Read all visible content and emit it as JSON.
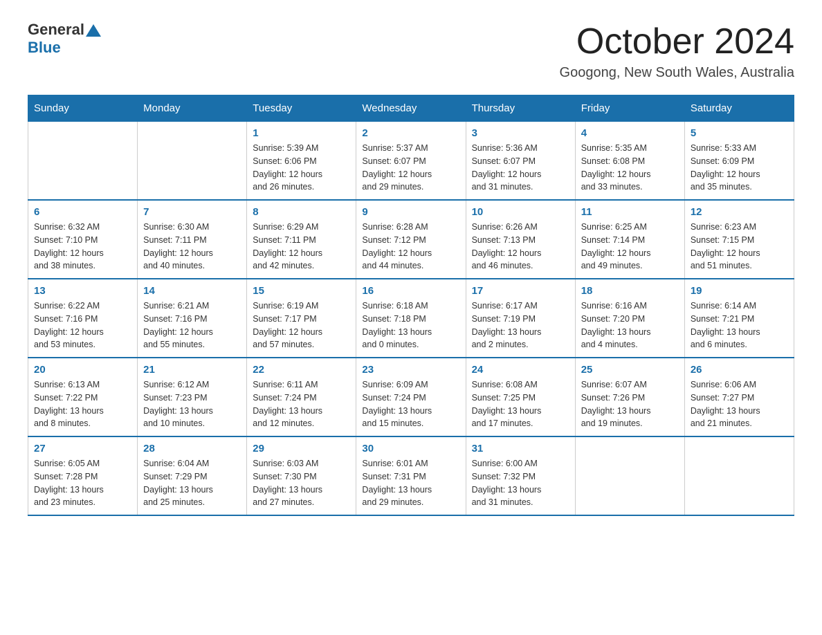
{
  "header": {
    "logo_general": "General",
    "logo_blue": "Blue",
    "title": "October 2024",
    "subtitle": "Googong, New South Wales, Australia"
  },
  "days_of_week": [
    "Sunday",
    "Monday",
    "Tuesday",
    "Wednesday",
    "Thursday",
    "Friday",
    "Saturday"
  ],
  "weeks": [
    [
      {
        "day": "",
        "info": ""
      },
      {
        "day": "",
        "info": ""
      },
      {
        "day": "1",
        "info": "Sunrise: 5:39 AM\nSunset: 6:06 PM\nDaylight: 12 hours\nand 26 minutes."
      },
      {
        "day": "2",
        "info": "Sunrise: 5:37 AM\nSunset: 6:07 PM\nDaylight: 12 hours\nand 29 minutes."
      },
      {
        "day": "3",
        "info": "Sunrise: 5:36 AM\nSunset: 6:07 PM\nDaylight: 12 hours\nand 31 minutes."
      },
      {
        "day": "4",
        "info": "Sunrise: 5:35 AM\nSunset: 6:08 PM\nDaylight: 12 hours\nand 33 minutes."
      },
      {
        "day": "5",
        "info": "Sunrise: 5:33 AM\nSunset: 6:09 PM\nDaylight: 12 hours\nand 35 minutes."
      }
    ],
    [
      {
        "day": "6",
        "info": "Sunrise: 6:32 AM\nSunset: 7:10 PM\nDaylight: 12 hours\nand 38 minutes."
      },
      {
        "day": "7",
        "info": "Sunrise: 6:30 AM\nSunset: 7:11 PM\nDaylight: 12 hours\nand 40 minutes."
      },
      {
        "day": "8",
        "info": "Sunrise: 6:29 AM\nSunset: 7:11 PM\nDaylight: 12 hours\nand 42 minutes."
      },
      {
        "day": "9",
        "info": "Sunrise: 6:28 AM\nSunset: 7:12 PM\nDaylight: 12 hours\nand 44 minutes."
      },
      {
        "day": "10",
        "info": "Sunrise: 6:26 AM\nSunset: 7:13 PM\nDaylight: 12 hours\nand 46 minutes."
      },
      {
        "day": "11",
        "info": "Sunrise: 6:25 AM\nSunset: 7:14 PM\nDaylight: 12 hours\nand 49 minutes."
      },
      {
        "day": "12",
        "info": "Sunrise: 6:23 AM\nSunset: 7:15 PM\nDaylight: 12 hours\nand 51 minutes."
      }
    ],
    [
      {
        "day": "13",
        "info": "Sunrise: 6:22 AM\nSunset: 7:16 PM\nDaylight: 12 hours\nand 53 minutes."
      },
      {
        "day": "14",
        "info": "Sunrise: 6:21 AM\nSunset: 7:16 PM\nDaylight: 12 hours\nand 55 minutes."
      },
      {
        "day": "15",
        "info": "Sunrise: 6:19 AM\nSunset: 7:17 PM\nDaylight: 12 hours\nand 57 minutes."
      },
      {
        "day": "16",
        "info": "Sunrise: 6:18 AM\nSunset: 7:18 PM\nDaylight: 13 hours\nand 0 minutes."
      },
      {
        "day": "17",
        "info": "Sunrise: 6:17 AM\nSunset: 7:19 PM\nDaylight: 13 hours\nand 2 minutes."
      },
      {
        "day": "18",
        "info": "Sunrise: 6:16 AM\nSunset: 7:20 PM\nDaylight: 13 hours\nand 4 minutes."
      },
      {
        "day": "19",
        "info": "Sunrise: 6:14 AM\nSunset: 7:21 PM\nDaylight: 13 hours\nand 6 minutes."
      }
    ],
    [
      {
        "day": "20",
        "info": "Sunrise: 6:13 AM\nSunset: 7:22 PM\nDaylight: 13 hours\nand 8 minutes."
      },
      {
        "day": "21",
        "info": "Sunrise: 6:12 AM\nSunset: 7:23 PM\nDaylight: 13 hours\nand 10 minutes."
      },
      {
        "day": "22",
        "info": "Sunrise: 6:11 AM\nSunset: 7:24 PM\nDaylight: 13 hours\nand 12 minutes."
      },
      {
        "day": "23",
        "info": "Sunrise: 6:09 AM\nSunset: 7:24 PM\nDaylight: 13 hours\nand 15 minutes."
      },
      {
        "day": "24",
        "info": "Sunrise: 6:08 AM\nSunset: 7:25 PM\nDaylight: 13 hours\nand 17 minutes."
      },
      {
        "day": "25",
        "info": "Sunrise: 6:07 AM\nSunset: 7:26 PM\nDaylight: 13 hours\nand 19 minutes."
      },
      {
        "day": "26",
        "info": "Sunrise: 6:06 AM\nSunset: 7:27 PM\nDaylight: 13 hours\nand 21 minutes."
      }
    ],
    [
      {
        "day": "27",
        "info": "Sunrise: 6:05 AM\nSunset: 7:28 PM\nDaylight: 13 hours\nand 23 minutes."
      },
      {
        "day": "28",
        "info": "Sunrise: 6:04 AM\nSunset: 7:29 PM\nDaylight: 13 hours\nand 25 minutes."
      },
      {
        "day": "29",
        "info": "Sunrise: 6:03 AM\nSunset: 7:30 PM\nDaylight: 13 hours\nand 27 minutes."
      },
      {
        "day": "30",
        "info": "Sunrise: 6:01 AM\nSunset: 7:31 PM\nDaylight: 13 hours\nand 29 minutes."
      },
      {
        "day": "31",
        "info": "Sunrise: 6:00 AM\nSunset: 7:32 PM\nDaylight: 13 hours\nand 31 minutes."
      },
      {
        "day": "",
        "info": ""
      },
      {
        "day": "",
        "info": ""
      }
    ]
  ]
}
